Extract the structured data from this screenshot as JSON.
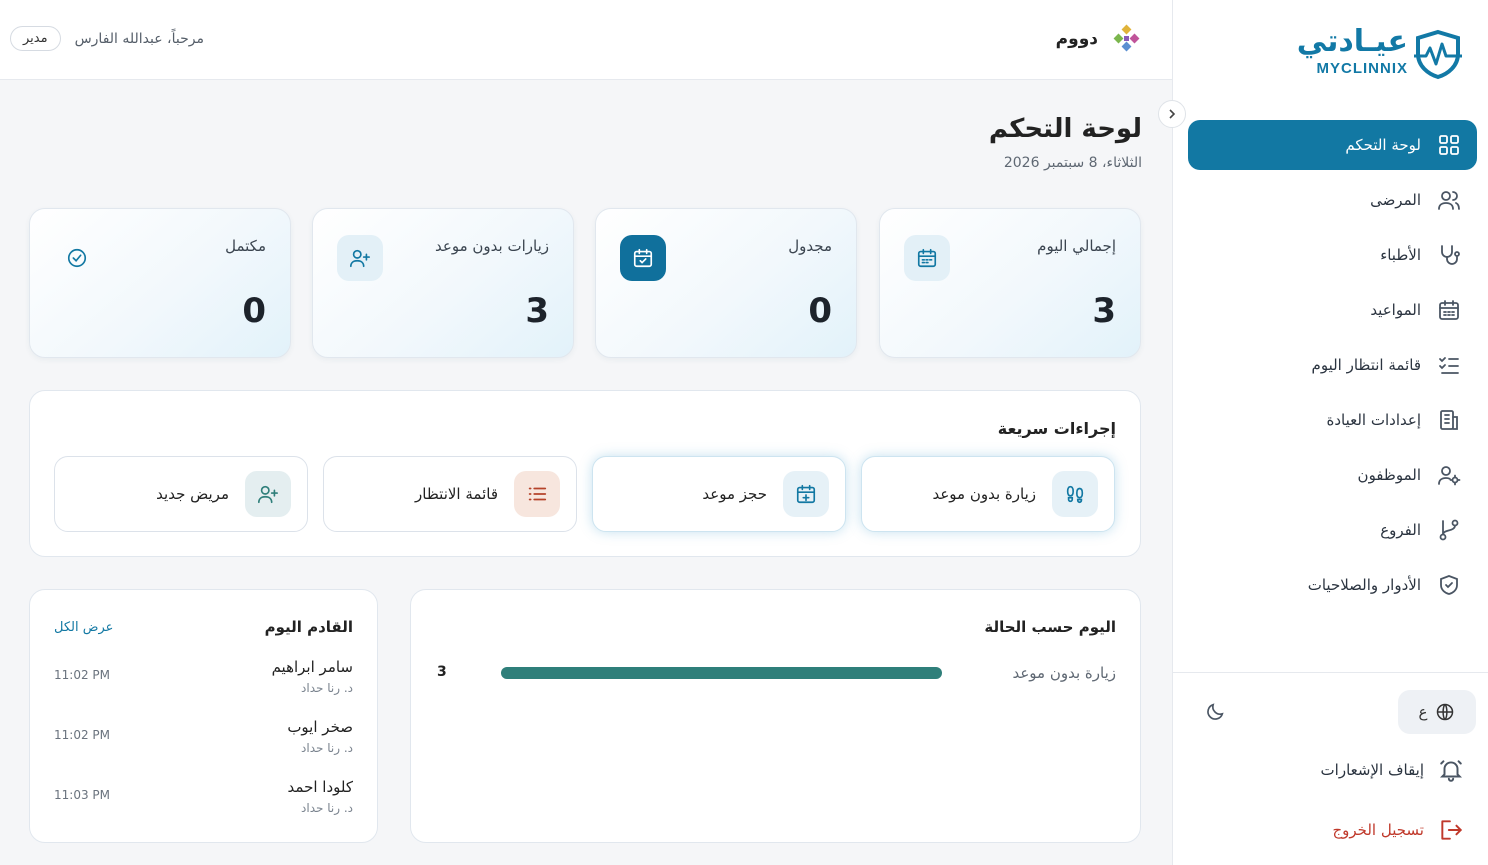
{
  "brand": {
    "logo_ar": "عيـادتي",
    "logo_en": "MYCLINNIX",
    "clinic_name": "دووم"
  },
  "user": {
    "welcome": "مرحباً، عبدالله الفارس",
    "role": "مدير"
  },
  "page": {
    "title": "لوحة التحكم",
    "date": "الثلاثاء، 8 سبتمبر 2026"
  },
  "sidebar": {
    "items": [
      {
        "label": "لوحة التحكم",
        "icon": "grid-icon",
        "active": true
      },
      {
        "label": "المرضى",
        "icon": "users-icon"
      },
      {
        "label": "الأطباء",
        "icon": "stethoscope-icon"
      },
      {
        "label": "المواعيد",
        "icon": "calendar-icon"
      },
      {
        "label": "قائمة انتظار اليوم",
        "icon": "checklist-icon"
      },
      {
        "label": "إعدادات العيادة",
        "icon": "building-icon"
      },
      {
        "label": "الموظفون",
        "icon": "user-gear-icon"
      },
      {
        "label": "الفروع",
        "icon": "branch-icon"
      },
      {
        "label": "الأدوار والصلاحيات",
        "icon": "shield-check-icon"
      }
    ],
    "language_label": "ع",
    "notifications_label": "إيقاف الإشعارات",
    "logout_label": "تسجيل الخروج"
  },
  "stats": [
    {
      "label": "إجمالي اليوم",
      "value": "3",
      "icon": "calendar-icon"
    },
    {
      "label": "مجدول",
      "value": "0",
      "icon": "calendar-check-icon"
    },
    {
      "label": "زيارات بدون موعد",
      "value": "3",
      "icon": "user-plus-icon"
    },
    {
      "label": "مكتمل",
      "value": "0",
      "icon": "check-circle-icon"
    }
  ],
  "quick_actions": {
    "title": "إجراءات سريعة",
    "items": [
      {
        "label": "زيارة بدون موعد",
        "icon": "footprints-icon"
      },
      {
        "label": "حجز موعد",
        "icon": "calendar-plus-icon"
      },
      {
        "label": "قائمة الانتظار",
        "icon": "list-icon"
      },
      {
        "label": "مريض جديد",
        "icon": "user-plus-icon"
      }
    ]
  },
  "status_today": {
    "title": "اليوم حسب الحالة",
    "rows": [
      {
        "label": "زيارة بدون موعد",
        "count": "3",
        "fraction": 1.0
      }
    ]
  },
  "upcoming": {
    "title": "القادم اليوم",
    "view_all": "عرض الكل",
    "items": [
      {
        "name": "سامر ابراهيم",
        "doctor": "د. رنا حداد",
        "time": "11:02 PM"
      },
      {
        "name": "صخر ايوب",
        "doctor": "د. رنا حداد",
        "time": "11:02 PM"
      },
      {
        "name": "كلودا احمد",
        "doctor": "د. رنا حداد",
        "time": "11:03 PM"
      }
    ]
  },
  "colors": {
    "primary": "#1278a3",
    "bar": "#2f7f7a",
    "logout": "#c0392b"
  }
}
